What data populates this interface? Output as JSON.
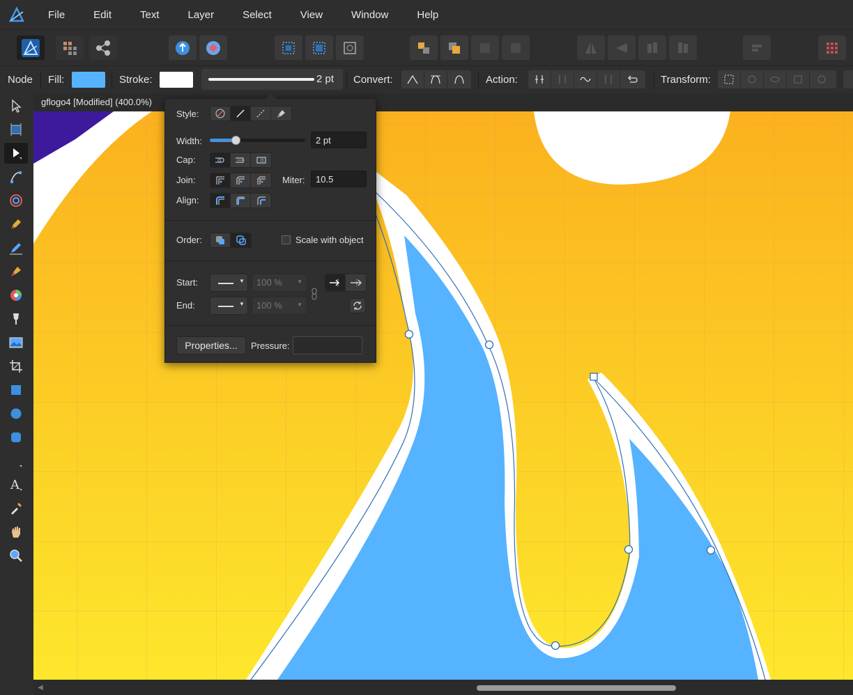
{
  "menu": [
    "File",
    "Edit",
    "Text",
    "Layer",
    "Select",
    "View",
    "Window",
    "Help"
  ],
  "context": {
    "tool_label": "Node",
    "fill_label": "Fill:",
    "fill_color": "#55b3ff",
    "stroke_label": "Stroke:",
    "stroke_color": "#ffffff",
    "width_value": "2 pt",
    "convert_label": "Convert:",
    "action_label": "Action:",
    "transform_label": "Transform:"
  },
  "document": {
    "title": "gflogo4 [Modified] (400.0%)"
  },
  "stroke_panel": {
    "style_label": "Style:",
    "width_label": "Width:",
    "width_value": "2 pt",
    "width_slider_level": 0.27,
    "cap_label": "Cap:",
    "join_label": "Join:",
    "miter_label": "Miter:",
    "miter_value": "10.5",
    "align_label": "Align:",
    "order_label": "Order:",
    "scale_label": "Scale with object",
    "scale_checked": false,
    "start_label": "Start:",
    "start_size": "100 %",
    "end_label": "End:",
    "end_size": "100 %",
    "properties_label": "Properties...",
    "pressure_label": "Pressure:"
  },
  "colors": {
    "accent": "#4a90d9",
    "canvas_top": "#fbb11e",
    "canvas_bottom": "#fde72c",
    "flame_blue": "#55b3ff",
    "logo_purple": "#3d1a9c"
  }
}
